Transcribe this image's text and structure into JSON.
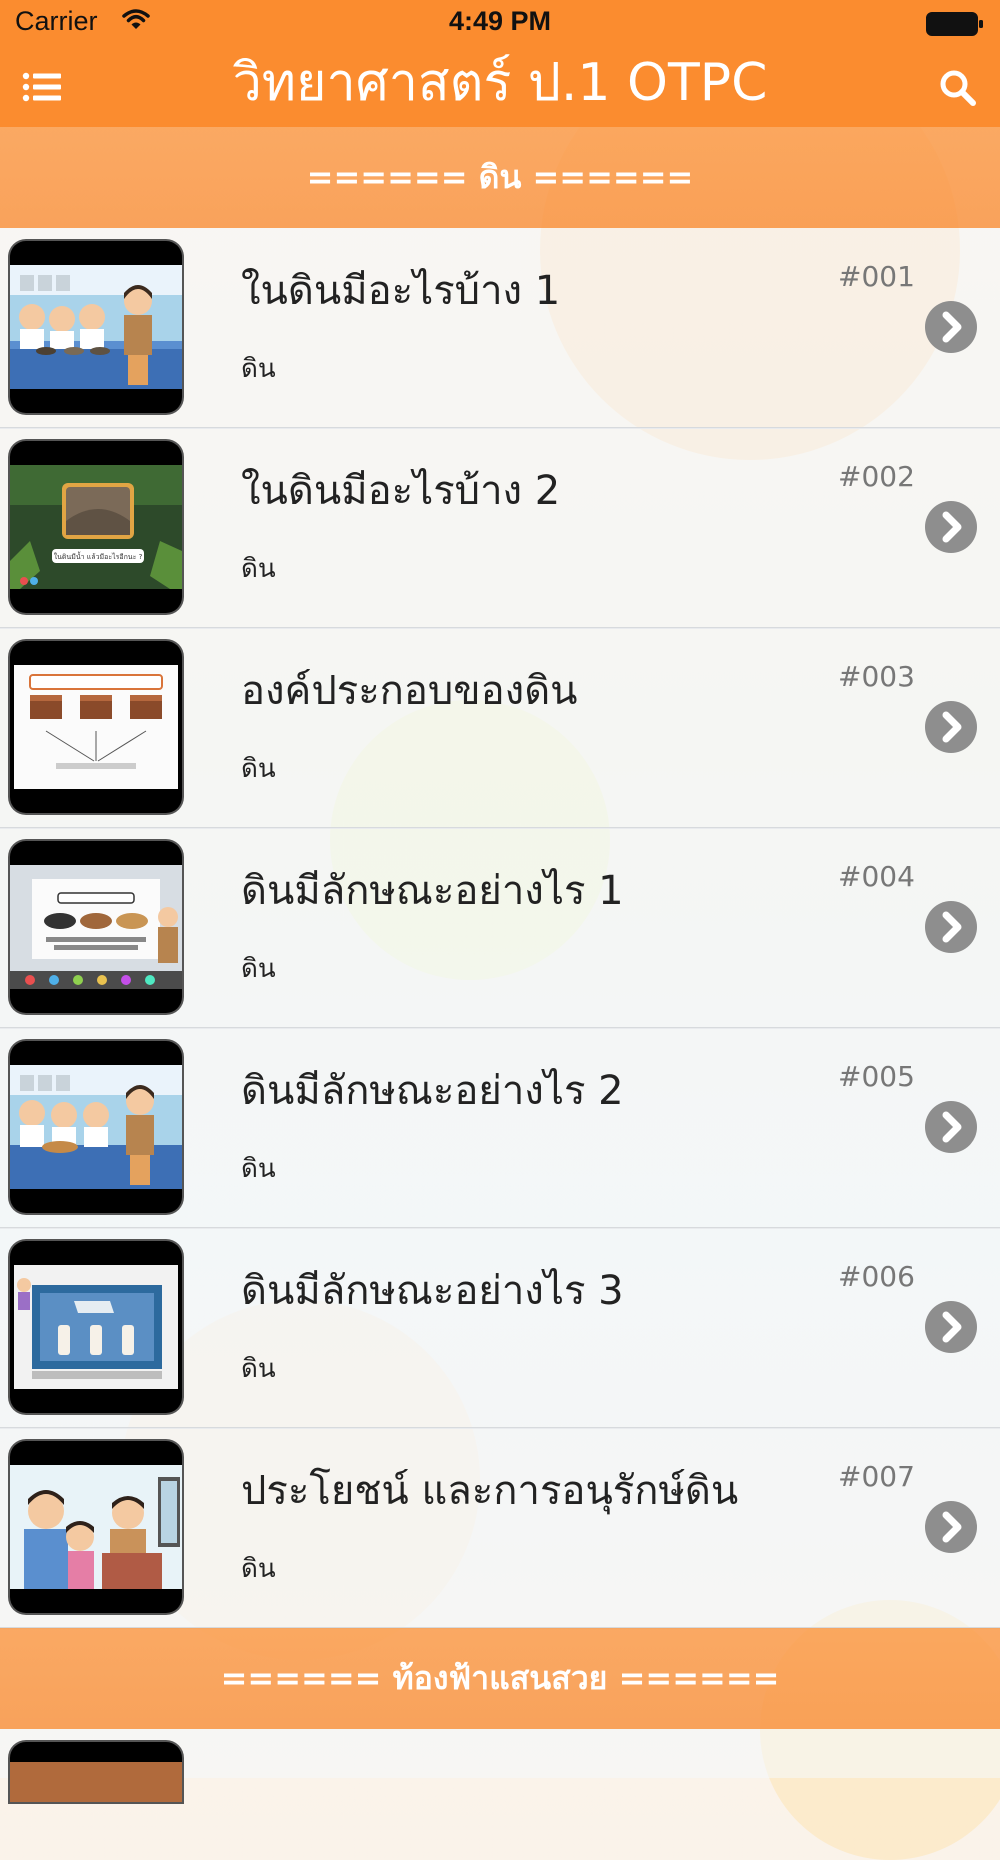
{
  "status_bar": {
    "carrier": "Carrier",
    "time": "4:49 PM"
  },
  "navbar": {
    "title": "วิทยาศาสตร์ ป.1 OTPC",
    "menu_icon": "list-icon",
    "search_icon": "search-icon"
  },
  "sections": [
    {
      "header": "====== ดิน ======"
    },
    {
      "header": "====== ท้องฟ้าแสนสวย ======"
    }
  ],
  "items": [
    {
      "title": "ในดินมีอะไรบ้าง 1",
      "code": "#001",
      "subtitle": "ดิน",
      "caption": ""
    },
    {
      "title": "ในดินมีอะไรบ้าง 2",
      "code": "#002",
      "subtitle": "ดิน",
      "caption": "ในดินมีน้ำ แล้วมีอะไรอีกนะ ?"
    },
    {
      "title": "องค์ประกอบของดิน",
      "code": "#003",
      "subtitle": "ดิน",
      "caption": ""
    },
    {
      "title": "ดินมีลักษณะอย่างไร 1",
      "code": "#004",
      "subtitle": "ดิน",
      "caption": ""
    },
    {
      "title": "ดินมีลักษณะอย่างไร 2",
      "code": "#005",
      "subtitle": "ดิน",
      "caption": ""
    },
    {
      "title": "ดินมีลักษณะอย่างไร 3",
      "code": "#006",
      "subtitle": "ดิน",
      "caption": ""
    },
    {
      "title": "ประโยชน์ และการอนุรักษ์ดิน",
      "code": "#007",
      "subtitle": "ดิน",
      "caption": ""
    }
  ],
  "colors": {
    "navbar": "#fb8c2f",
    "section_header": "#f9944b",
    "chevron": "#8e8e8e"
  },
  "icons": {
    "chevron": "chevron-right-icon"
  }
}
